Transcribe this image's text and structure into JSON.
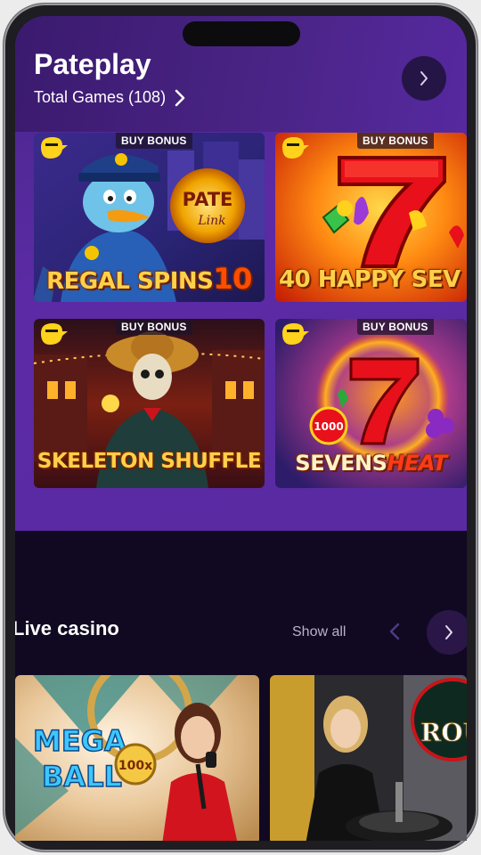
{
  "provider": {
    "title": "Pateplay",
    "games_label": "Total Games (108)",
    "next_icon": "chevron-right-icon"
  },
  "games": [
    {
      "badge": "BUY BONUS",
      "title_line1": "REGAL SPINS",
      "title_num": "10",
      "extra": "PATE"
    },
    {
      "badge": "BUY BONUS",
      "title_line1": "40 HAPPY SEV",
      "extra": "7"
    },
    {
      "badge": "BUY BONUS",
      "title_line1": "SKELETON SHUFFLE"
    },
    {
      "badge": "BUY BONUS",
      "title_line1": "SEVENS",
      "title_line2": "HEAT",
      "extra": "1000"
    }
  ],
  "live": {
    "title": "Live casino",
    "show_all": "Show all",
    "prev_icon": "chevron-left-icon",
    "next_icon": "chevron-right-icon",
    "cards": [
      {
        "name": "MEGA BALL",
        "mult": "100x"
      },
      {
        "name": "ROU"
      }
    ]
  },
  "colors": {
    "provider_bg": "#5a2aa3",
    "page_bg": "#110921",
    "badge_bg": "#1e1428",
    "accent_gold": "#ffd04a"
  }
}
